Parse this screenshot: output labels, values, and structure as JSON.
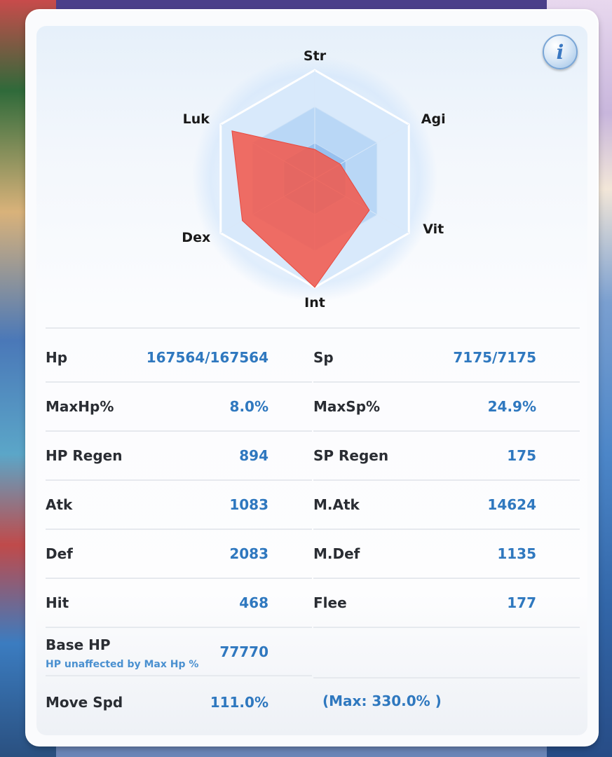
{
  "radar": {
    "axes": [
      "Str",
      "Agi",
      "Vit",
      "Int",
      "Dex",
      "Luk"
    ],
    "values": [
      0.27,
      0.27,
      0.58,
      1.0,
      0.77,
      0.88
    ]
  },
  "stats": {
    "left": [
      {
        "label": "Hp",
        "value": "167564/167564"
      },
      {
        "label": "MaxHp%",
        "value": "8.0%"
      },
      {
        "label": "HP Regen",
        "value": "894"
      },
      {
        "label": "Atk",
        "value": "1083"
      },
      {
        "label": "Def",
        "value": "2083"
      },
      {
        "label": "Hit",
        "value": "468"
      }
    ],
    "right": [
      {
        "label": "Sp",
        "value": "7175/7175"
      },
      {
        "label": "MaxSp%",
        "value": "24.9%"
      },
      {
        "label": "SP Regen",
        "value": "175"
      },
      {
        "label": "M.Atk",
        "value": "14624"
      },
      {
        "label": "M.Def",
        "value": "1135"
      },
      {
        "label": "Flee",
        "value": "177"
      }
    ]
  },
  "base_hp": {
    "label": "Base HP",
    "value": "77770",
    "note": "HP unaffected by Max Hp %"
  },
  "move_spd": {
    "label": "Move Spd",
    "value": "111.0%",
    "max": "(Max: 330.0% )"
  },
  "colors": {
    "value": "#2f78bf",
    "radar_fill": "#f05a4f",
    "grid": "#a9cdf3"
  },
  "icons": {
    "info": "info-icon"
  }
}
